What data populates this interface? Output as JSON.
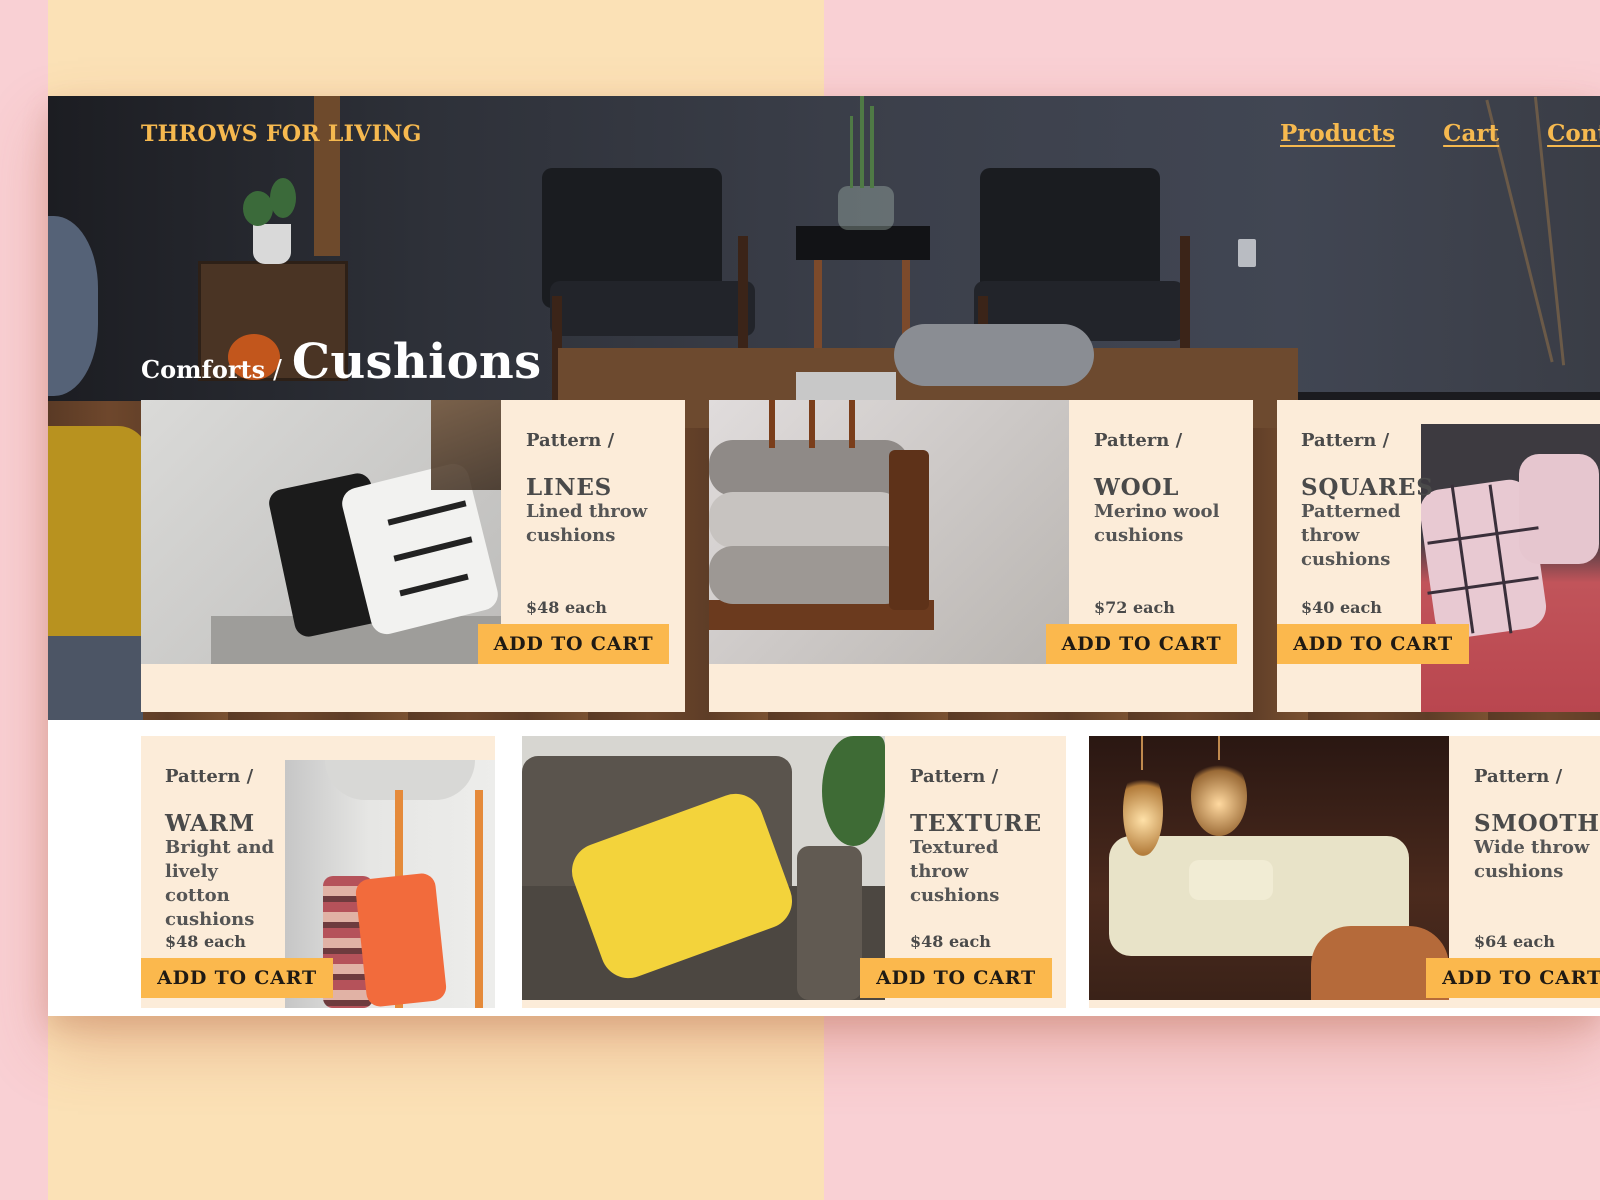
{
  "brand": "THROWS FOR LIVING",
  "nav": {
    "products": "Products",
    "cart": "Cart",
    "contact": "Conta"
  },
  "breadcrumb": {
    "parent": "Comforts",
    "separator": "/",
    "current": "Cushions"
  },
  "colors": {
    "accent": "#f6b94f",
    "button": "#fbb84d",
    "card_bg": "#fcecd9",
    "backdrop_left": "#fbe1b6",
    "backdrop_right": "#f9d0d4"
  },
  "products": [
    {
      "kicker": "Pattern /",
      "title": "LINES",
      "desc": "Lined throw cushions",
      "price": "$48 each",
      "button": "ADD TO CART",
      "photo": "black-white-arrow-cushions"
    },
    {
      "kicker": "Pattern /",
      "title": "WOOL",
      "desc": "Merino wool cushions",
      "price": "$72 each",
      "button": "ADD TO CART",
      "photo": "stacked-wool-cushions-on-chair"
    },
    {
      "kicker": "Pattern /",
      "title": "SQUARES",
      "desc": "Patterned throw cushions",
      "price": "$40 each",
      "button": "ADD TO CART",
      "photo": "grid-pattern-cushions-on-red-sofa"
    },
    {
      "kicker": "Pattern /",
      "title": "WARM",
      "desc": "Bright and lively cotton cushions",
      "price": "$48 each",
      "button": "ADD TO CART",
      "photo": "orange-and-striped-cushions-on-chair"
    },
    {
      "kicker": "Pattern /",
      "title": "TEXTURE",
      "desc": "Textured throw cushions",
      "price": "$48 each",
      "button": "ADD TO CART",
      "photo": "yellow-cushion-on-grey-sofa"
    },
    {
      "kicker": "Pattern /",
      "title": "SMOOTH",
      "desc": "Wide throw cushions",
      "price": "$64 each",
      "button": "ADD TO CART",
      "photo": "cream-sofa-with-bulb-lights"
    }
  ]
}
